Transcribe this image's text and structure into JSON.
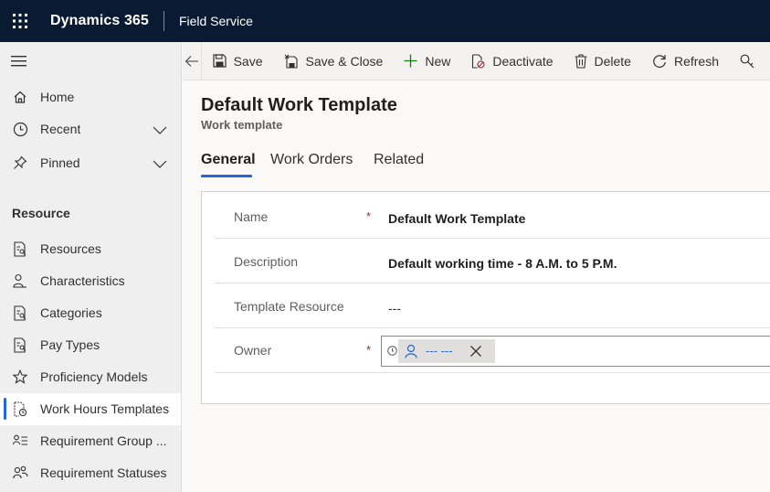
{
  "topbar": {
    "brand": "Dynamics 365",
    "app": "Field Service"
  },
  "nav": {
    "items": [
      {
        "label": "Home",
        "icon": "home-icon"
      },
      {
        "label": "Recent",
        "icon": "clock-icon"
      },
      {
        "label": "Pinned",
        "icon": "pin-icon"
      }
    ],
    "section_title": "Resource",
    "section_items": [
      {
        "label": "Resources"
      },
      {
        "label": "Characteristics"
      },
      {
        "label": "Categories"
      },
      {
        "label": "Pay Types"
      },
      {
        "label": "Proficiency Models"
      },
      {
        "label": "Work Hours Templates"
      },
      {
        "label": "Requirement Group ..."
      },
      {
        "label": "Requirement Statuses"
      }
    ]
  },
  "commands": {
    "save": "Save",
    "save_close": "Save & Close",
    "new": "New",
    "deactivate": "Deactivate",
    "delete": "Delete",
    "refresh": "Refresh"
  },
  "record": {
    "title": "Default Work Template",
    "entity": "Work template"
  },
  "tabs": {
    "general": "General",
    "work_orders": "Work Orders",
    "related": "Related"
  },
  "form": {
    "name_label": "Name",
    "name_value": "Default Work Template",
    "description_label": "Description",
    "description_value": "Default working time - 8 A.M. to 5 P.M.",
    "template_resource_label": "Template Resource",
    "template_resource_value": "---",
    "owner_label": "Owner",
    "owner_value": "--- ---",
    "required_mark": "*"
  },
  "colors": {
    "topbar": "#0b1a33",
    "accent": "#2266e3",
    "required": "#a4262c"
  }
}
